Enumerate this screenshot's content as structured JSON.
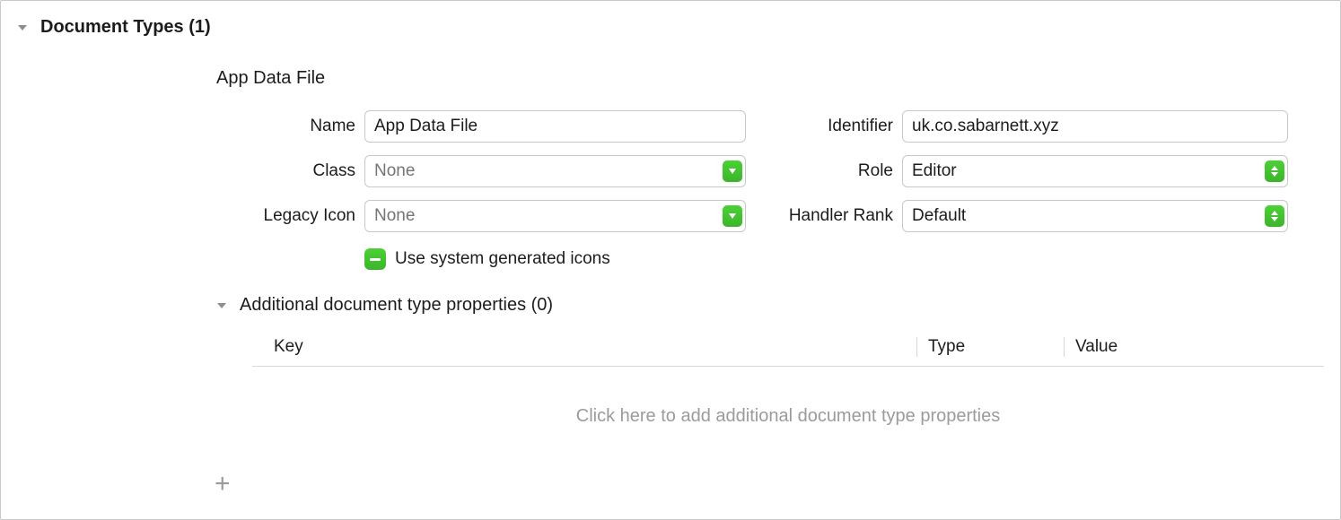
{
  "section": {
    "title": "Document Types (1)"
  },
  "doc": {
    "title": "App Data File",
    "fields": {
      "name_label": "Name",
      "name_value": "App Data File",
      "class_label": "Class",
      "class_placeholder": "None",
      "legacy_icon_label": "Legacy Icon",
      "legacy_icon_placeholder": "None",
      "identifier_label": "Identifier",
      "identifier_value": "uk.co.sabarnett.xyz",
      "role_label": "Role",
      "role_value": "Editor",
      "handler_rank_label": "Handler Rank",
      "handler_rank_value": "Default"
    },
    "checkbox_label": "Use system generated icons"
  },
  "additional": {
    "title": "Additional document type properties (0)",
    "columns": {
      "key": "Key",
      "type": "Type",
      "value": "Value"
    },
    "empty": "Click here to add additional document type properties"
  }
}
